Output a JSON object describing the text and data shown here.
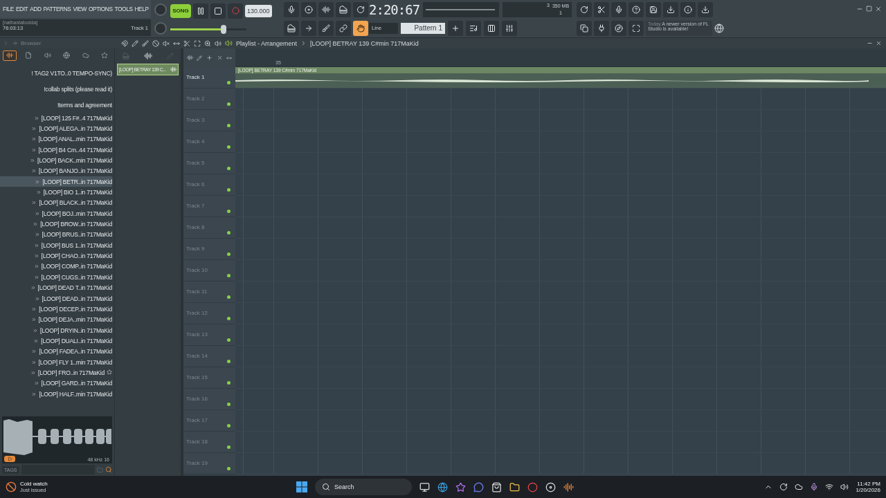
{
  "menu": [
    "FILE",
    "EDIT",
    "ADD",
    "PATTERNS",
    "VIEW",
    "OPTIONS",
    "TOOLS",
    "HELP"
  ],
  "hint": {
    "user": "[nathanlabodda]",
    "time": "76:03:13",
    "track": "Track 1"
  },
  "transport": {
    "mode": "SONG",
    "song_mode": true,
    "tempo": "130.000",
    "clock": "2:20:67",
    "master_volume": {
      "level": 0.72
    }
  },
  "monitor": {
    "voices": "3",
    "memory": "350 MB",
    "cores": "1"
  },
  "snap": "Line",
  "pattern": "Pattern 1",
  "snap_tools": [
    {
      "selected": false
    },
    {
      "selected": false
    },
    {
      "selected": false
    },
    {
      "selected": false
    },
    {
      "selected": true
    }
  ],
  "news": {
    "date": "Today",
    "message": "A newer version of FL Studio is available!"
  },
  "browser": {
    "title": "Browser",
    "tabs": [
      {
        "selected": true
      },
      {
        "selected": false
      },
      {
        "selected": false
      },
      {
        "selected": false
      },
      {
        "selected": false
      },
      {
        "selected": false
      }
    ],
    "items": [
      {
        "kind": "file",
        "label": "! TAG2 V1TO..0 TEMPO-SYNC)",
        "selected": false,
        "starred": false
      },
      {
        "kind": "file",
        "label": "!collab splits (please read it)",
        "selected": false,
        "starred": false
      },
      {
        "kind": "file",
        "label": "!terms and agreement",
        "selected": false,
        "starred": false
      },
      {
        "kind": "loop",
        "label": "[LOOP] 125 F#..4 717MaKid",
        "selected": false,
        "starred": false
      },
      {
        "kind": "loop",
        "label": "[LOOP] ALEGA..in 717MaKid",
        "selected": false,
        "starred": false
      },
      {
        "kind": "loop",
        "label": "[LOOP] ANAL..min 717MaKid",
        "selected": false,
        "starred": false
      },
      {
        "kind": "loop",
        "label": "[LOOP] B4 Cm..44 717MaKid",
        "selected": false,
        "starred": false
      },
      {
        "kind": "loop",
        "label": "[LOOP] BACK..min 717MaKid",
        "selected": false,
        "starred": false
      },
      {
        "kind": "loop",
        "label": "[LOOP] BANJO..in 717MaKid",
        "selected": false,
        "starred": false
      },
      {
        "kind": "loop",
        "label": "[LOOP] BETR..in 717MaKid",
        "selected": true,
        "starred": false
      },
      {
        "kind": "loop",
        "label": "[LOOP] BIO 1..in 717MaKid",
        "selected": false,
        "starred": false
      },
      {
        "kind": "loop",
        "label": "[LOOP] BLACK..in 717MaKid",
        "selected": false,
        "starred": false
      },
      {
        "kind": "loop",
        "label": "[LOOP] BOJ..min 717MaKid",
        "selected": false,
        "starred": false
      },
      {
        "kind": "loop",
        "label": "[LOOP] BROW..in 717MaKid",
        "selected": false,
        "starred": false
      },
      {
        "kind": "loop",
        "label": "[LOOP] BRUS..in 717MaKid",
        "selected": false,
        "starred": false
      },
      {
        "kind": "loop",
        "label": "[LOOP] BUS 1..in 717MaKid",
        "selected": false,
        "starred": false
      },
      {
        "kind": "loop",
        "label": "[LOOP] CHAO..in 717MaKid",
        "selected": false,
        "starred": false
      },
      {
        "kind": "loop",
        "label": "[LOOP] COMP..in 717MaKid",
        "selected": false,
        "starred": false
      },
      {
        "kind": "loop",
        "label": "[LOOP] CUGS..in 717MaKid",
        "selected": false,
        "starred": false
      },
      {
        "kind": "loop",
        "label": "[LOOP] DEAD T..in 717MaKid",
        "selected": false,
        "starred": false
      },
      {
        "kind": "loop",
        "label": "[LOOP] DEAD..in 717MaKid",
        "selected": false,
        "starred": false
      },
      {
        "kind": "loop",
        "label": "[LOOP] DECEP..in 717MaKid",
        "selected": false,
        "starred": false
      },
      {
        "kind": "loop",
        "label": "[LOOP] DEJA..min 717MaKid",
        "selected": false,
        "starred": false
      },
      {
        "kind": "loop",
        "label": "[LOOP] DRYIN..in 717MaKid",
        "selected": false,
        "starred": false
      },
      {
        "kind": "loop",
        "label": "[LOOP] DUALI..in 717MaKid",
        "selected": false,
        "starred": false
      },
      {
        "kind": "loop",
        "label": "[LOOP] FADEA..in 717MaKid",
        "selected": false,
        "starred": false
      },
      {
        "kind": "loop",
        "label": "[LOOP] FLY 1..min 717MaKid",
        "selected": false,
        "starred": false
      },
      {
        "kind": "loop",
        "label": "[LOOP] FRO..in 717MaKid",
        "selected": false,
        "starred": true
      },
      {
        "kind": "loop",
        "label": "[LOOP] GARD..in 717MaKid",
        "selected": false,
        "starred": false
      },
      {
        "kind": "loop",
        "label": "[LOOP] HALF..min 717MaKid",
        "selected": false,
        "starred": false
      }
    ],
    "preview": {
      "format": "48 kHz 16"
    },
    "tags_label": "TAGS"
  },
  "picker": [
    {
      "label": "[LOOP] BETRAY 139 C...",
      "selected": true
    }
  ],
  "playlist": {
    "title": "Playlist - Arrangement",
    "pattern": "[LOOP] BETRAY 139 C#min 717MaKid",
    "ruler": [
      "35"
    ],
    "tracks": [
      {
        "name": "Track 1",
        "clip": "[LOOP] BETRAY 139 C#min 717MaKid"
      },
      {
        "name": "Track 2"
      },
      {
        "name": "Track 3"
      },
      {
        "name": "Track 4"
      },
      {
        "name": "Track 5"
      },
      {
        "name": "Track 6"
      },
      {
        "name": "Track 7"
      },
      {
        "name": "Track 8"
      },
      {
        "name": "Track 9"
      },
      {
        "name": "Track 10"
      },
      {
        "name": "Track 11"
      },
      {
        "name": "Track 12"
      },
      {
        "name": "Track 13"
      },
      {
        "name": "Track 14"
      },
      {
        "name": "Track 15"
      },
      {
        "name": "Track 16"
      },
      {
        "name": "Track 17"
      },
      {
        "name": "Track 18"
      },
      {
        "name": "Track 19"
      }
    ]
  },
  "taskbar": {
    "notice": {
      "title": "Cold watch",
      "subtitle": "Just issued"
    },
    "search": "Search",
    "time": "11:42 PM",
    "date": "1/20/2026"
  }
}
